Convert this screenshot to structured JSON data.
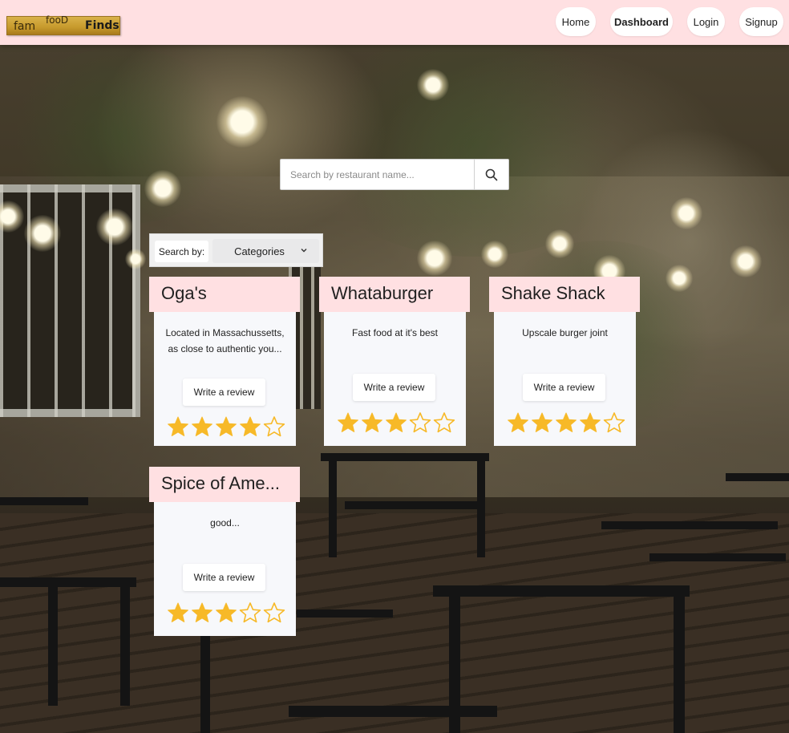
{
  "brand": {
    "logo_parts": [
      "fam",
      "fooD",
      "Finds"
    ]
  },
  "nav": {
    "items": [
      {
        "label": "Home",
        "bold": false
      },
      {
        "label": "Dashboard",
        "bold": true
      },
      {
        "label": "Login",
        "bold": false
      },
      {
        "label": "Signup",
        "bold": false
      }
    ]
  },
  "search": {
    "placeholder": "Search by restaurant name...",
    "value": "",
    "button_icon": "search-icon"
  },
  "filter": {
    "label": "Search by:",
    "selected": "Categories",
    "icon": "chevron-down-icon"
  },
  "restaurants": [
    {
      "name": "Oga's",
      "description": "Located in Massachussetts, as close to authentic you...",
      "button": "Write a review",
      "rating": 4,
      "max_rating": 5
    },
    {
      "name": "Whataburger",
      "description": "Fast food at it's best",
      "button": "Write a review",
      "rating": 3,
      "max_rating": 5
    },
    {
      "name": "Shake Shack",
      "description": "Upscale burger joint",
      "button": "Write a review",
      "rating": 4,
      "max_rating": 5
    },
    {
      "name": "Spice of Ame...",
      "description": "good...",
      "button": "Write a review",
      "rating": 3,
      "max_rating": 5
    }
  ],
  "colors": {
    "navbar": "#ffe0e2",
    "card_title": "#ffe0e2",
    "star": "#f7b928",
    "card_bg": "#f7f8fb"
  }
}
